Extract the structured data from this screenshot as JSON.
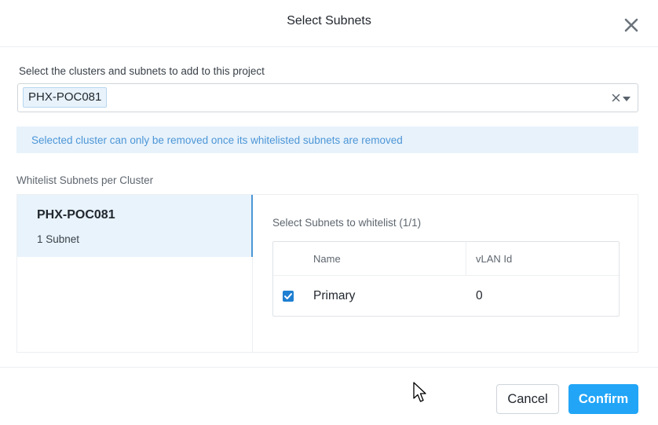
{
  "dialog": {
    "title": "Select Subnets"
  },
  "cluster_selector": {
    "label": "Select the clusters and subnets to add to this project",
    "selected_tags": [
      "PHX-POC081"
    ]
  },
  "info_banner": {
    "text": "Selected cluster can only be removed once its whitelisted subnets are removed",
    "color": "#4c96d7"
  },
  "whitelist": {
    "section_label": "Whitelist Subnets per Cluster",
    "clusters": [
      {
        "name": "PHX-POC081",
        "subnet_count": "1 Subnet",
        "selected": true
      }
    ],
    "subnets_title": "Select Subnets to whitelist (1/1)",
    "table": {
      "columns": [
        "Name",
        "vLAN Id"
      ],
      "rows": [
        {
          "checked": true,
          "name": "Primary",
          "vlan_id": "0"
        }
      ]
    }
  },
  "footer": {
    "cancel_label": "Cancel",
    "confirm_label": "Confirm"
  },
  "icons": {
    "close": "close-icon",
    "clear": "clear-icon",
    "dropdown": "chevron-down-icon",
    "checkbox": "checkmark-icon",
    "pointer": "mouse-pointer-icon"
  },
  "colors": {
    "accent": "#22a5f7",
    "selected_bg": "#e8f3fc",
    "checkbox": "#1f7fd1"
  }
}
